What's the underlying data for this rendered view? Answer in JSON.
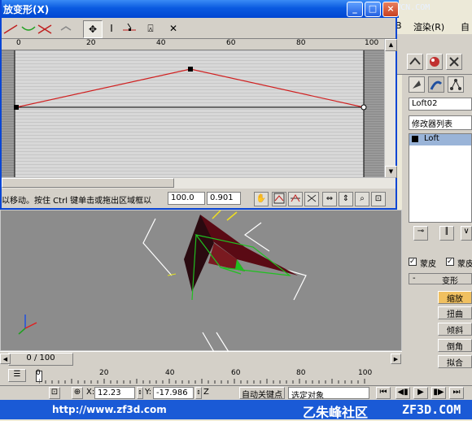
{
  "dialog": {
    "title": "放变形(X)",
    "watermark": "BBS.JCWCN.COM",
    "ruler_ticks": [
      "0",
      "20",
      "40",
      "60",
      "80",
      "100"
    ],
    "prompt": "以移动。按住 Ctrl 键单击或拖出区域框以",
    "x_value": "100.0",
    "y_value": "0.901",
    "curve_color": "#d02020"
  },
  "menu": {
    "item_render": "渲染(R)",
    "item_other": "自"
  },
  "command_panel": {
    "object_name": "Loft02",
    "modifier_list": "修改器列表",
    "stack_item": "Loft",
    "checkbox_skin": "蒙皮",
    "checkbox_skin2": "蒙皮",
    "rollout_title": "变形",
    "buttons": [
      "缩放",
      "扭曲",
      "倾斜",
      "倒角",
      "拟合"
    ]
  },
  "timeline": {
    "frame_label": "0 / 100",
    "ticks": [
      "0",
      "20",
      "40",
      "60",
      "80",
      "100"
    ]
  },
  "statusbar": {
    "x_label": "X:",
    "x_value": "12.23",
    "y_label": "Y:",
    "y_value": "-17.986",
    "z_label": "Z",
    "auto_key": "自动关键点",
    "selection": "选定对象"
  },
  "footer": {
    "url": "http://www.zf3d.com",
    "brand_cn": "朱峰社区",
    "brand_en": "ZF3D.COM"
  }
}
